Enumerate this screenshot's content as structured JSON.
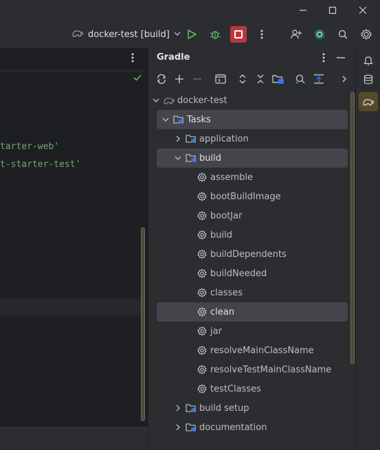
{
  "window": {
    "minimize_icon": "minimize-icon",
    "maximize_icon": "maximize-icon",
    "close_icon": "close-icon"
  },
  "toolbar": {
    "run_config_label": "docker-test [build]",
    "colors": {
      "run": "#5fb865",
      "stop_bg": "#b8383d"
    }
  },
  "editor": {
    "lines": [
      {
        "text": "tarter-web'"
      },
      {
        "text": "t-starter-test'"
      }
    ],
    "status_icon": "checkmark-icon"
  },
  "gradle": {
    "title": "Gradle",
    "tree": [
      {
        "label": "docker-test",
        "level": 0,
        "expanded": true,
        "icon": "gradle-elephant-icon",
        "selected": false
      },
      {
        "label": "Tasks",
        "level": 1,
        "expanded": true,
        "icon": "folder-icon",
        "selected": true
      },
      {
        "label": "application",
        "level": 2,
        "expanded": false,
        "icon": "folder-icon",
        "selected": false
      },
      {
        "label": "build",
        "level": 2,
        "expanded": true,
        "icon": "folder-icon",
        "selected": true
      },
      {
        "label": "assemble",
        "level": 3,
        "icon": "gear-icon",
        "selected": false
      },
      {
        "label": "bootBuildImage",
        "level": 3,
        "icon": "gear-icon",
        "selected": false
      },
      {
        "label": "bootJar",
        "level": 3,
        "icon": "gear-icon",
        "selected": false
      },
      {
        "label": "build",
        "level": 3,
        "icon": "gear-icon",
        "selected": false
      },
      {
        "label": "buildDependents",
        "level": 3,
        "icon": "gear-icon",
        "selected": false
      },
      {
        "label": "buildNeeded",
        "level": 3,
        "icon": "gear-icon",
        "selected": false
      },
      {
        "label": "classes",
        "level": 3,
        "icon": "gear-icon",
        "selected": false
      },
      {
        "label": "clean",
        "level": 3,
        "icon": "gear-icon",
        "selected": true
      },
      {
        "label": "jar",
        "level": 3,
        "icon": "gear-icon",
        "selected": false
      },
      {
        "label": "resolveMainClassName",
        "level": 3,
        "icon": "gear-icon",
        "selected": false
      },
      {
        "label": "resolveTestMainClassName",
        "level": 3,
        "icon": "gear-icon",
        "selected": false
      },
      {
        "label": "testClasses",
        "level": 3,
        "icon": "gear-icon",
        "selected": false
      },
      {
        "label": "build setup",
        "level": 2,
        "expanded": false,
        "icon": "folder-icon",
        "selected": false
      },
      {
        "label": "documentation",
        "level": 2,
        "expanded": false,
        "icon": "folder-icon",
        "selected": false
      }
    ]
  },
  "right_strip": {
    "items": [
      "notifications-icon",
      "database-icon",
      "gradle-elephant-icon"
    ]
  }
}
